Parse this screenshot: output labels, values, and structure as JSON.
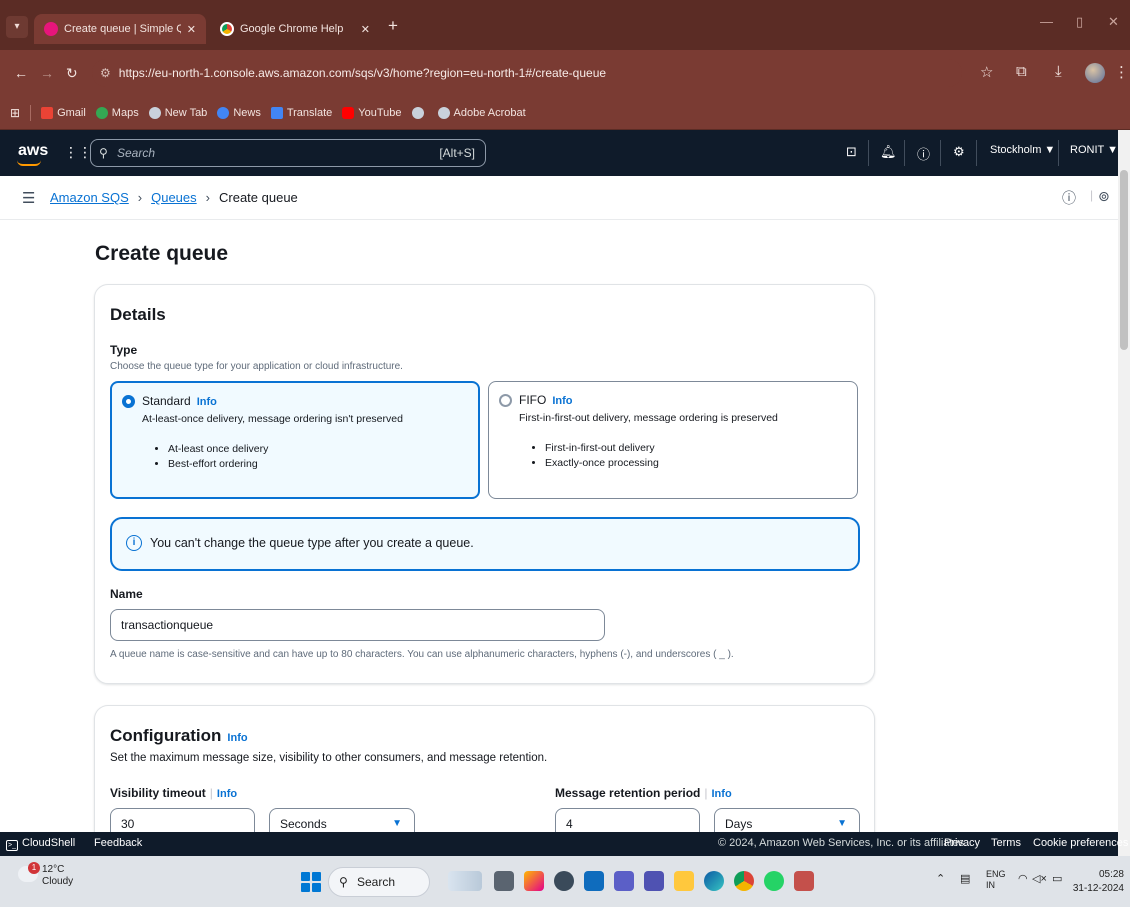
{
  "browser": {
    "tabs": [
      {
        "title": "Create queue | Simple Queue Se",
        "active": true
      },
      {
        "title": "Google Chrome Help",
        "active": false
      }
    ],
    "url": "https://eu-north-1.console.aws.amazon.com/sqs/v3/home?region=eu-north-1#/create-queue",
    "bookmarks": [
      "Gmail",
      "Maps",
      "New Tab",
      "News",
      "Translate",
      "YouTube",
      "",
      "Adobe Acrobat"
    ]
  },
  "aws_nav": {
    "logo": "aws",
    "search_placeholder": "Search",
    "shortcut": "[Alt+S]",
    "region": "Stockholm ▼",
    "account": "RONIT ▼"
  },
  "breadcrumb": {
    "items": [
      "Amazon SQS",
      "Queues",
      "Create queue"
    ],
    "separator": "›"
  },
  "page": {
    "title": "Create queue"
  },
  "details": {
    "heading": "Details",
    "type_label": "Type",
    "type_desc": "Choose the queue type for your application or cloud infrastructure.",
    "info": "Info",
    "standard": {
      "title": "Standard",
      "desc": "At-least-once delivery, message ordering isn't preserved",
      "bullets": [
        "At-least once delivery",
        "Best-effort ordering"
      ],
      "selected": true
    },
    "fifo": {
      "title": "FIFO",
      "desc": "First-in-first-out delivery, message ordering is preserved",
      "bullets": [
        "First-in-first-out delivery",
        "Exactly-once processing"
      ],
      "selected": false
    },
    "alert": "You can't change the queue type after you create a queue.",
    "name_label": "Name",
    "name_value": "transactionqueue",
    "name_hint": "A queue name is case-sensitive and can have up to 80 characters. You can use alphanumeric characters, hyphens (-), and underscores ( _ )."
  },
  "configuration": {
    "heading": "Configuration",
    "info": "Info",
    "desc": "Set the maximum message size, visibility to other consumers, and message retention.",
    "visibility_label": "Visibility timeout",
    "visibility_value": "30",
    "visibility_unit": "Seconds",
    "retention_label": "Message retention period",
    "retention_value": "4",
    "retention_unit": "Days"
  },
  "footer": {
    "cloudshell": "CloudShell",
    "feedback": "Feedback",
    "copyright": "© 2024, Amazon Web Services, Inc. or its affiliates.",
    "privacy": "Privacy",
    "terms": "Terms",
    "cookie": "Cookie preferences"
  },
  "taskbar": {
    "weather_temp": "12°C",
    "weather_cond": "Cloudy",
    "weather_badge": "1",
    "search": "Search",
    "lang_top": "ENG",
    "lang_bottom": "IN",
    "time": "05:28",
    "date": "31-12-2024"
  },
  "colors": {
    "accent": "#0972d3",
    "aws_nav": "#0f1b2a",
    "chrome_frame": "#7a3b33"
  }
}
